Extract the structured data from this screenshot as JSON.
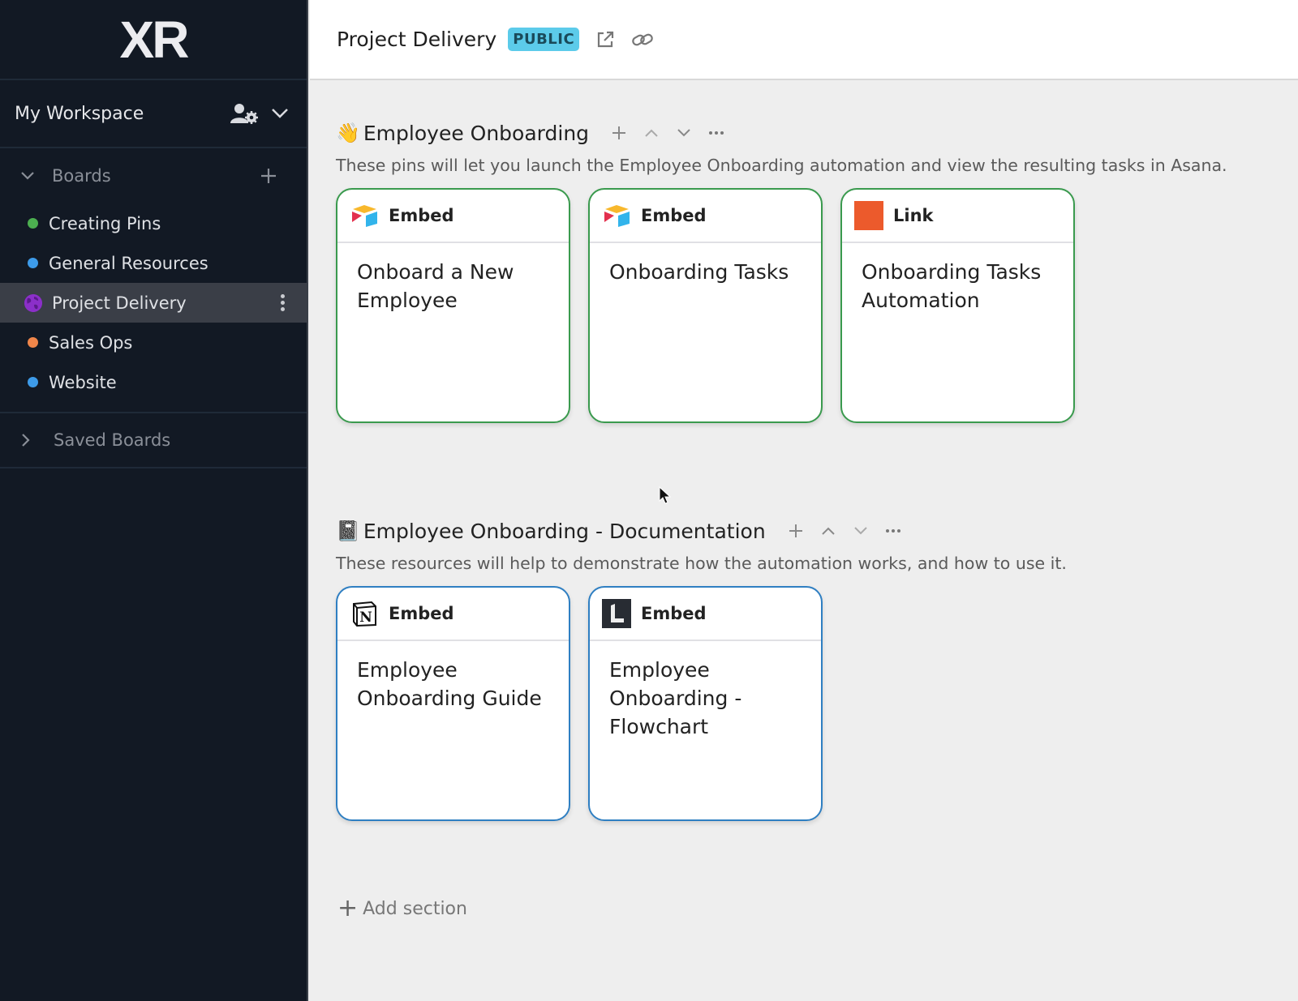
{
  "app": {
    "logo_text": "XR"
  },
  "sidebar": {
    "workspace_name": "My Workspace",
    "workspace_icons": [
      "user-gear-icon",
      "chevron-down-icon"
    ],
    "boards_label": "Boards",
    "boards": [
      {
        "label": "Creating Pins",
        "color": "#4caf50",
        "icon": "dot"
      },
      {
        "label": "General Resources",
        "color": "#3d9be9",
        "icon": "dot"
      },
      {
        "label": "Project Delivery",
        "color": "#8b2fc9",
        "icon": "globe-icon",
        "active": true
      },
      {
        "label": "Sales Ops",
        "color": "#f0864a",
        "icon": "dot"
      },
      {
        "label": "Website",
        "color": "#3d9be9",
        "icon": "dot"
      }
    ],
    "saved_boards_label": "Saved Boards"
  },
  "header": {
    "title": "Project Delivery",
    "badge": "PUBLIC",
    "badge_color": "#5ccbea",
    "icons": [
      "external-link-icon",
      "link-icon"
    ]
  },
  "sections": [
    {
      "emoji": "👋",
      "title": "Employee Onboarding",
      "description": "These pins will let you launch the Employee Onboarding automation and view the resulting tasks in Asana.",
      "border_color": "#3a9a4e",
      "cards": [
        {
          "type": "Embed",
          "icon": "airtable-icon",
          "title": "Onboard a New Employee"
        },
        {
          "type": "Embed",
          "icon": "airtable-icon",
          "title": "Onboarding Tasks"
        },
        {
          "type": "Link",
          "icon": "orange-square-icon",
          "title": "Onboarding Tasks Automation"
        }
      ]
    },
    {
      "emoji": "📓",
      "title": "Employee Onboarding - Documentation",
      "description": "These resources will help to demonstrate how the automation works, and how to use it.",
      "border_color": "#2f7fc2",
      "cards": [
        {
          "type": "Embed",
          "icon": "notion-icon",
          "title": "Employee Onboarding Guide"
        },
        {
          "type": "Embed",
          "icon": "lucid-icon",
          "title": "Employee Onboarding - Flowchart"
        }
      ]
    }
  ],
  "add_section_label": "Add section"
}
